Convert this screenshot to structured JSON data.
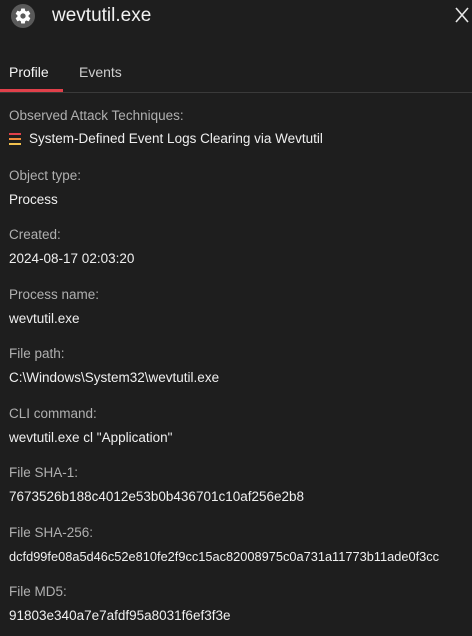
{
  "header": {
    "title": "wevtutil.exe",
    "icon": "gear-icon",
    "close_icon": "close-icon"
  },
  "tabs": [
    {
      "label": "Profile",
      "active": true
    },
    {
      "label": "Events",
      "active": false
    }
  ],
  "accent_color": "#e0404a",
  "technique_icon_colors": [
    "#e0404a",
    "#f08a3c",
    "#f2c14e"
  ],
  "fields": {
    "techniques": {
      "label": "Observed Attack Techniques:",
      "value": "System-Defined Event Logs Clearing via Wevtutil"
    },
    "object_type": {
      "label": "Object type:",
      "value": "Process"
    },
    "created": {
      "label": "Created:",
      "value": "2024-08-17 02:03:20"
    },
    "process_name": {
      "label": "Process name:",
      "value": "wevtutil.exe"
    },
    "file_path": {
      "label": "File path:",
      "value": "C:\\Windows\\System32\\wevtutil.exe"
    },
    "cli_command": {
      "label": "CLI command:",
      "value": "wevtutil.exe cl \"Application\""
    },
    "sha1": {
      "label": "File SHA-1:",
      "value": "7673526b188c4012e53b0b436701c10af256e2b8"
    },
    "sha256": {
      "label": "File SHA-256:",
      "value": "dcfd99fe08a5d46c52e810fe2f9cc15ac82008975c0a731a11773b11ade0f3cc"
    },
    "md5": {
      "label": "File MD5:",
      "value": "91803e340a7e7afdf95a8031f6ef3f3e"
    }
  }
}
